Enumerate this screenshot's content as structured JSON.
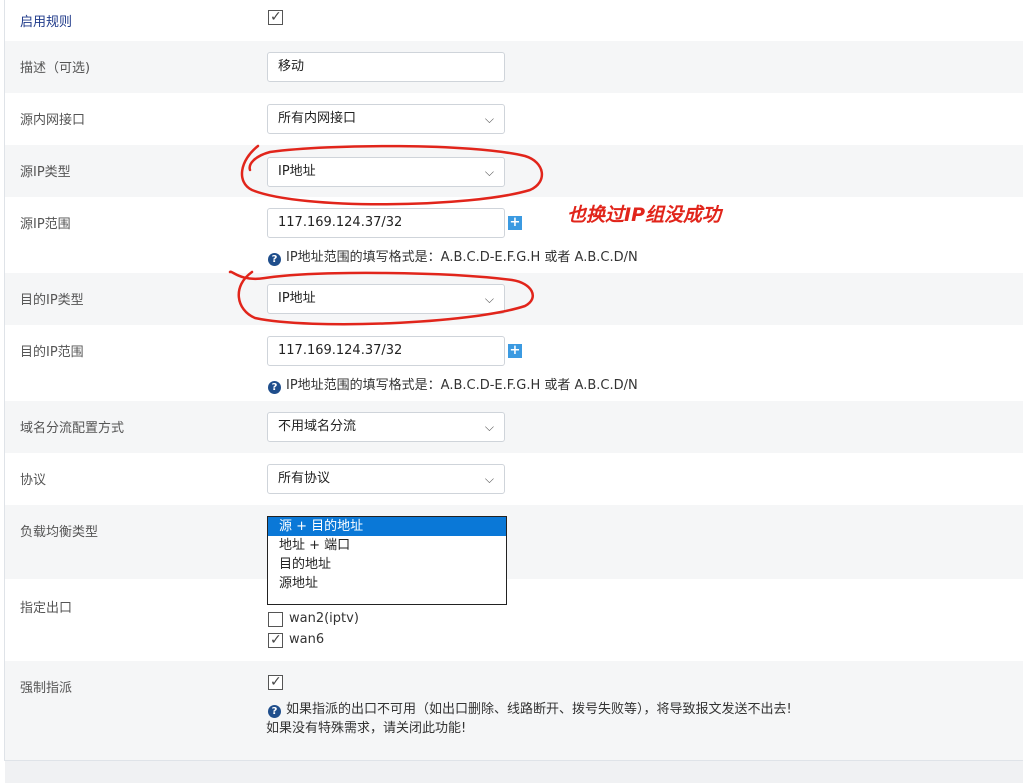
{
  "rows": {
    "enable": {
      "label": "启用规则",
      "checked": true
    },
    "desc": {
      "label": "描述（可选)",
      "value": "移动"
    },
    "src_iface": {
      "label": "源内网接口",
      "value": "所有内网接口"
    },
    "src_ip_type": {
      "label": "源IP类型",
      "value": "IP地址"
    },
    "src_ip_range": {
      "label": "源IP范围",
      "value": "117.169.124.37/32",
      "hint": "IP地址范围的填写格式是：A.B.C.D-E.F.G.H 或者 A.B.C.D/N"
    },
    "dst_ip_type": {
      "label": "目的IP类型",
      "value": "IP地址"
    },
    "dst_ip_range": {
      "label": "目的IP范围",
      "value": "117.169.124.37/32",
      "hint": "IP地址范围的填写格式是：A.B.C.D-E.F.G.H 或者 A.B.C.D/N"
    },
    "domain_mode": {
      "label": "域名分流配置方式",
      "value": "不用域名分流"
    },
    "protocol": {
      "label": "协议",
      "value": "所有协议"
    },
    "lb_type": {
      "label": "负载均衡类型",
      "options": [
        "源 + 目的地址",
        "地址 + 端口",
        "目的地址",
        "源地址"
      ],
      "selected": "源 + 目的地址"
    },
    "egress": {
      "label": "指定出口",
      "items": [
        {
          "name": "wan2(iptv)",
          "checked": false
        },
        {
          "name": "wan6",
          "checked": true
        }
      ]
    },
    "force": {
      "label": "强制指派",
      "checked": true,
      "hint1": "如果指派的出口不可用（如出口删除、线路断开、拨号失败等），将导致报文发送不出去!",
      "hint2": "如果没有特殊需求，请关闭此功能!"
    }
  },
  "annotation": "也换过IP组没成功",
  "icons": {
    "check": "check-icon",
    "chevron": "chevron-down-icon",
    "plus": "plus-icon",
    "help": "question-circle-icon"
  },
  "colors": {
    "accent": "#0a78d7",
    "annotation": "#e1251b",
    "help_icon": "#1f4e8c",
    "plus_btn": "#3b9ae1"
  }
}
